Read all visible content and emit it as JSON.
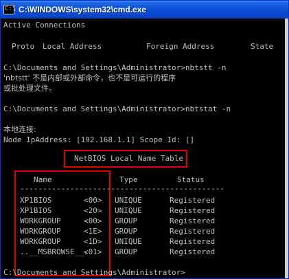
{
  "window": {
    "title": "C:\\WINDOWS\\system32\\cmd.exe",
    "icon_text": "C:\\"
  },
  "console": {
    "active_connections": "Active Connections",
    "conn_header": {
      "proto": "Proto",
      "local_address": "Local Address",
      "foreign_address": "Foreign Address",
      "state": "State"
    },
    "cmd1": "C:\\Documents and Settings\\Administrator>nbtstt -n",
    "err1": "'nbtstt' 不是内部或外部命令，也不是可运行的程序",
    "err2": "或批处理文件。",
    "cmd2": "C:\\Documents and Settings\\Administrator>nbtstat -n",
    "conn_name": "本地连接:",
    "node_ip": "Node IpAddress: [192.168.1.1] Scope Id: []",
    "table_title": "NetBIOS Local Name Table",
    "table_headers": {
      "name": "Name",
      "type": "Type",
      "status": "Status"
    },
    "table_rule": "---------------------------------------------",
    "table_rows": [
      {
        "name": "XP1BIOS",
        "suffix": "<00>",
        "type": "UNIQUE",
        "status": "Registered"
      },
      {
        "name": "XP1BIOS",
        "suffix": "<20>",
        "type": "UNIQUE",
        "status": "Registered"
      },
      {
        "name": "WORKGROUP",
        "suffix": "<00>",
        "type": "GROUP",
        "status": "Registered"
      },
      {
        "name": "WORKGROUP",
        "suffix": "<1E>",
        "type": "GROUP",
        "status": "Registered"
      },
      {
        "name": "WORKGROUP",
        "suffix": "<1D>",
        "type": "UNIQUE",
        "status": "Registered"
      },
      {
        "name": "..__MSBROWSE__.",
        "suffix": "<01>",
        "type": "GROUP",
        "status": "Registered"
      }
    ],
    "prompt_final": "C:\\Documents and Settings\\Administrator>"
  },
  "colors": {
    "console_bg": "#000000",
    "console_text": "#c0c0c0",
    "titlebar": "#0a4fd6",
    "highlight_box": "#e00000"
  }
}
